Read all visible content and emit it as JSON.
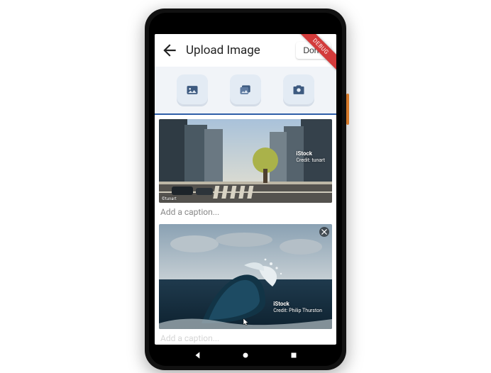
{
  "ribbon": "DEBUG",
  "header": {
    "title": "Upload Image",
    "done_label": "Done"
  },
  "actions": [
    {
      "name": "image-single-icon"
    },
    {
      "name": "gallery-icon"
    },
    {
      "name": "camera-icon"
    }
  ],
  "cards": [
    {
      "watermark_brand": "iStock",
      "watermark_credit": "Credit: tunart",
      "caption_placeholder": "Add a caption...",
      "corner_credit": "©tunart"
    },
    {
      "watermark_brand": "iStock",
      "watermark_credit": "Credit: Philip Thurston",
      "caption_placeholder": "Add a caption..."
    }
  ]
}
